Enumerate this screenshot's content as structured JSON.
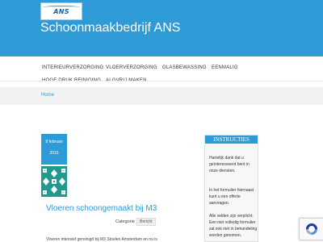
{
  "header": {
    "logo_text": "ANS",
    "site_title": "Schoonmaakbedrijf ANS",
    "background_color": "#2f9bd6"
  },
  "nav": {
    "items": [
      {
        "label": "INTERIEURVERZORGING"
      },
      {
        "label": "VLOERVERZORGING"
      },
      {
        "label": "GLASBEWASSING"
      },
      {
        "label": "EENMALIG"
      },
      {
        "label": "HOGE DRUK REINIGING"
      },
      {
        "label": "ALGVRIJ MAKEN"
      }
    ]
  },
  "breadcrumb": {
    "home": "Home"
  },
  "post": {
    "date_day": "8 februari",
    "date_year": "2015",
    "title": "Vloeren schoongemaakt bij M3",
    "category_label": "Categorie :",
    "category": "Bericht",
    "excerpt": "Vloeren intensief gereinigd bij M3 Stoelen Amsterdam en nu is"
  },
  "widget": {
    "title": "INSTRUCTIES",
    "p1": "Hartelijk dank dat u geïnteresseerd bent in onze diensten.",
    "p2": "In het formulier hiernaast kunt u een offerte aanvragen.",
    "p3": "Alle velden zijn verplicht. Een niet volledig formulier zal ook niet in behandeling worden genomen."
  },
  "icons": {
    "recaptcha": "recaptcha-icon",
    "thumbnail": "pattern-thumbnail"
  },
  "colors": {
    "accent": "#2f9bd6",
    "thumbnail": "#1f9a8e"
  }
}
